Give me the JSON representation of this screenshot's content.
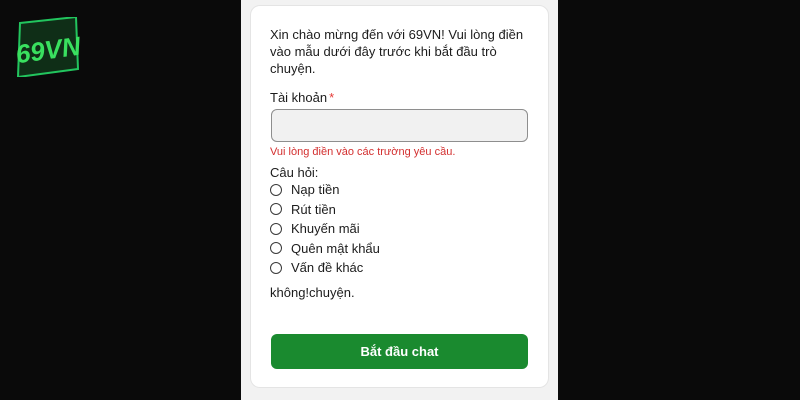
{
  "brand": {
    "logo_text": "69VN",
    "logo_color": "#22c55e"
  },
  "form": {
    "intro": "Xin chào mừng đến với 69VN! Vui lòng điền vào mẫu dưới đây trước khi bắt đầu trò chuyện.",
    "account_label": "Tài khoản",
    "required_mark": "*",
    "account_value": "",
    "error_message": "Vui lòng điền vào các trường yêu cầu.",
    "question_label": "Câu hỏi:",
    "options": [
      {
        "label": "Nạp tiền",
        "selected": false
      },
      {
        "label": "Rút tiền",
        "selected": false
      },
      {
        "label": "Khuyến mãi",
        "selected": false
      },
      {
        "label": "Quên mật khẩu",
        "selected": false
      },
      {
        "label": "Vấn đề khác",
        "selected": false
      }
    ],
    "note": "không!chuyện.",
    "submit_label": "Bắt đầu chat"
  },
  "colors": {
    "page_background": "#0a0a0a",
    "accent_button": "#1a8a2f",
    "error": "#d32f2f"
  }
}
